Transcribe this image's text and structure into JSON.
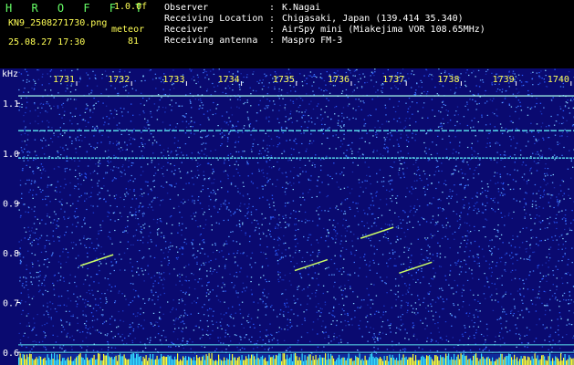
{
  "header": {
    "brand": "H R O F F T",
    "version": "1.0.0f",
    "filename": "KN9_2508271730.png",
    "datetime": "25.08.27 17:30",
    "meteor_label": "meteor",
    "meteor_count": "81",
    "info_rows": [
      {
        "key": "Observer",
        "sep": ":",
        "value": "K.Nagai"
      },
      {
        "key": "Receiving Location",
        "sep": ":",
        "value": "Chigasaki, Japan (139.414 35.340)"
      },
      {
        "key": "Receiver",
        "sep": ":",
        "value": "AirSpy mini (Miakejima VOR 108.65MHz)"
      },
      {
        "key": "Receiving antenna",
        "sep": ":",
        "value": "Maspro FM-3"
      }
    ]
  },
  "plot": {
    "y_unit": "kHz",
    "y_ticks": [
      "1.1",
      "1.0",
      "0.9",
      "0.8",
      "0.7",
      "0.6"
    ],
    "x_ticks": [
      "1731",
      "1732",
      "1733",
      "1734",
      "1735",
      "1736",
      "1737",
      "1738",
      "1739",
      "1740"
    ],
    "colors": {
      "background": "#0a0a70",
      "noise": "#2a5bff",
      "line": "#66ffff",
      "meteor": "#ccff66",
      "baseline": "#ffff33"
    }
  },
  "chart_data": {
    "type": "heatmap",
    "xlabel": "",
    "ylabel": "kHz",
    "x_ticks": [
      "1731",
      "1732",
      "1733",
      "1734",
      "1735",
      "1736",
      "1737",
      "1738",
      "1739",
      "1740"
    ],
    "ylim": [
      0.58,
      1.17
    ],
    "horizontal_lines_khz": [
      1.115,
      1.045,
      0.99,
      0.615,
      0.6
    ],
    "meteors": [
      {
        "x_time": "1731.8",
        "y_khz": 0.785
      },
      {
        "x_time": "1735.7",
        "y_khz": 0.775
      },
      {
        "x_time": "1736.9",
        "y_khz": 0.84
      },
      {
        "x_time": "1737.6",
        "y_khz": 0.77
      }
    ]
  }
}
